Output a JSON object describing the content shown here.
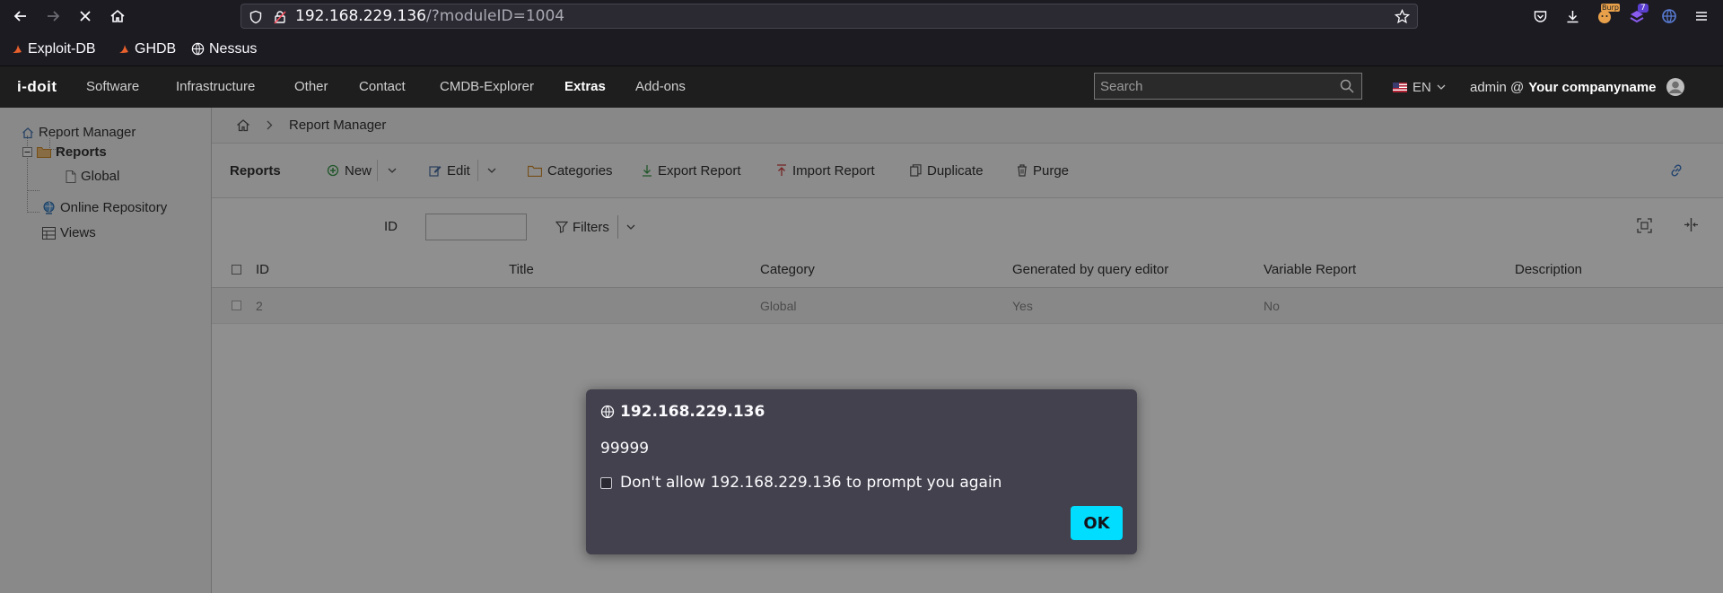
{
  "browser": {
    "url_host": "192.168.229.136",
    "url_path": "/?moduleID=1004",
    "bookmarks": [
      {
        "label": "Exploit-DB",
        "icon": "exploitdb-icon"
      },
      {
        "label": "GHDB",
        "icon": "ghdb-icon"
      },
      {
        "label": "Nessus",
        "icon": "globe-icon"
      }
    ],
    "extension_badge": "7",
    "burp_badge": "Burp"
  },
  "app": {
    "logo": "i-doit",
    "nav": [
      "Software",
      "Infrastructure",
      "Other",
      "Contact",
      "CMDB-Explorer",
      "Extras",
      "Add-ons"
    ],
    "active_nav": "Extras",
    "search_placeholder": "Search",
    "language": "EN",
    "user_prefix": "admin @",
    "company": "Your companyname"
  },
  "tree": {
    "root": "Report Manager",
    "reports": "Reports",
    "global": "Global",
    "online_repository": "Online Repository",
    "views": "Views"
  },
  "breadcrumb": {
    "current": "Report Manager"
  },
  "toolbar": {
    "title": "Reports",
    "new": "New",
    "edit": "Edit",
    "categories": "Categories",
    "export": "Export Report",
    "import": "Import Report",
    "duplicate": "Duplicate",
    "purge": "Purge"
  },
  "filters": {
    "id_label": "ID",
    "id_value": "",
    "filters_label": "Filters"
  },
  "table": {
    "columns": [
      "ID",
      "Title",
      "Category",
      "Generated by query editor",
      "Variable Report",
      "Description"
    ],
    "rows": [
      {
        "id": "2",
        "title": "",
        "category": "Global",
        "query_editor": "Yes",
        "variable": "No",
        "description": ""
      }
    ]
  },
  "dialog": {
    "origin": "192.168.229.136",
    "message": "99999",
    "checkbox_label": "Don't allow 192.168.229.136 to prompt you again",
    "ok_label": "OK"
  },
  "colors": {
    "accent_ok": "#00ddff",
    "header_bg": "#1e1e1e",
    "folder": "#e8a040"
  }
}
